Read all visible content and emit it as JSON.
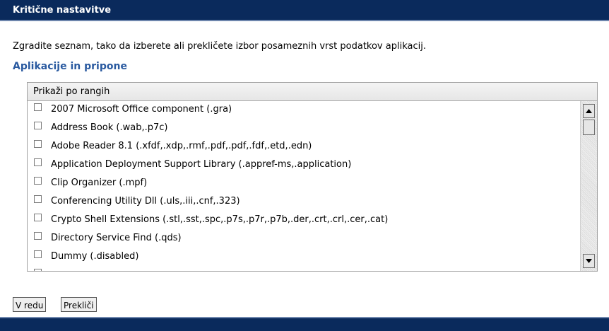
{
  "header": {
    "title": "Kritične nastavitve"
  },
  "description": "Zgradite seznam, tako da izberete ali prekličete izbor posameznih vrst podatkov aplikacij.",
  "section": {
    "title": "Aplikacije in pripone",
    "list_header": "Prikaži po rangih",
    "items": [
      {
        "label": "2007 Microsoft Office component (.gra)",
        "checked": false
      },
      {
        "label": "Address Book (.wab,.p7c)",
        "checked": false
      },
      {
        "label": "Adobe Reader 8.1 (.xfdf,.xdp,.rmf,.pdf,.pdf,.fdf,.etd,.edn)",
        "checked": false
      },
      {
        "label": "Application Deployment Support Library (.appref-ms,.application)",
        "checked": false
      },
      {
        "label": "Clip Organizer (.mpf)",
        "checked": false
      },
      {
        "label": "Conferencing Utility Dll (.uls,.iii,.cnf,.323)",
        "checked": false
      },
      {
        "label": "Crypto Shell Extensions (.stl,.sst,.spc,.p7s,.p7r,.p7b,.der,.crt,.crl,.cer,.cat)",
        "checked": false
      },
      {
        "label": "Directory Service Find (.qds)",
        "checked": false
      },
      {
        "label": "Dummy (.disabled)",
        "checked": false
      }
    ]
  },
  "buttons": {
    "ok": "V redu",
    "cancel": "Prekliči"
  },
  "colors": {
    "header_bg": "#0a2a5c",
    "section_title": "#2a5aa0"
  },
  "icons": {
    "scroll_up": "scroll-up-arrow",
    "scroll_down": "scroll-down-arrow"
  }
}
